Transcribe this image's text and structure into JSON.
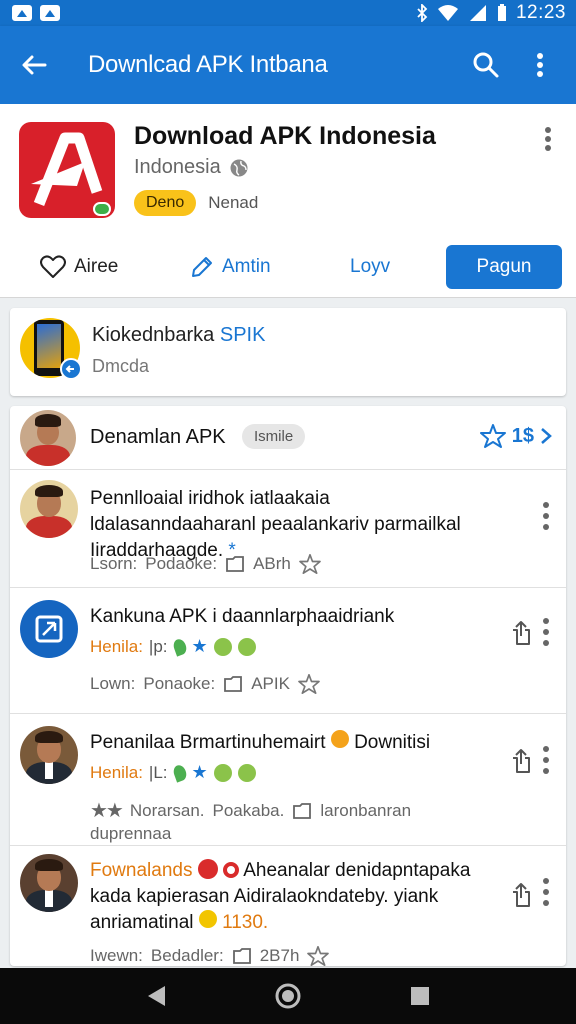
{
  "status_bar": {
    "time": "12:23"
  },
  "app_bar": {
    "title": "Downlcad APK Intbana"
  },
  "app": {
    "name": "Download APK Indonesia",
    "region": "Indonesia",
    "tag": "Deno",
    "tag_text": "Nenad"
  },
  "actions": {
    "like": "Airee",
    "edit": "Amtin",
    "login": "Loyv",
    "primary": "Pagun"
  },
  "featured": {
    "title_main": "Kiokednbarka",
    "title_accent": "SPIK",
    "subtitle": "Dmcda"
  },
  "list": {
    "header": {
      "title": "Denamlan APK",
      "chip": "Ismile",
      "rating": "1$"
    },
    "items": [
      {
        "title": "Pennlloaial iridhok iatlaakaia ldalasanndaaharanl peaalankariv parmailkal Iiraddarhaagde.",
        "meta_a": "Lsorn:",
        "meta_b": "Podaoke:",
        "meta_c": "ABrh"
      },
      {
        "title": "Kankuna APK i daannlarphaaidriank",
        "sub_label": "Henila:",
        "sub_value": "|p:",
        "meta_a": "Lown:",
        "meta_b": "Ponaoke:",
        "meta_c": "APIK"
      },
      {
        "title": "Penanilaa Brmartinuhemairt",
        "title_tail": "Downitisi",
        "sub_label": "Henila:",
        "sub_value": "|L:",
        "meta_a": "Norarsan.",
        "meta_b": "Poakaba.",
        "meta_c": "laronbanran",
        "meta_d": "duprennaa"
      },
      {
        "title_accent": "Fownalands",
        "title": "Aheanalar denidapntapaka",
        "line2": "kada kapierasan Aidiralaokndateby. yiank",
        "line3": "anriamatinal",
        "line3_tail": "1130.",
        "meta_a": "Iwewn:",
        "meta_b": "Bedadler:",
        "meta_c": "2B7h"
      }
    ]
  },
  "colors": {
    "primary": "#1976d2",
    "app_icon": "#d8202a",
    "tag": "#f9c21a",
    "accent_orange": "#e07a10"
  }
}
